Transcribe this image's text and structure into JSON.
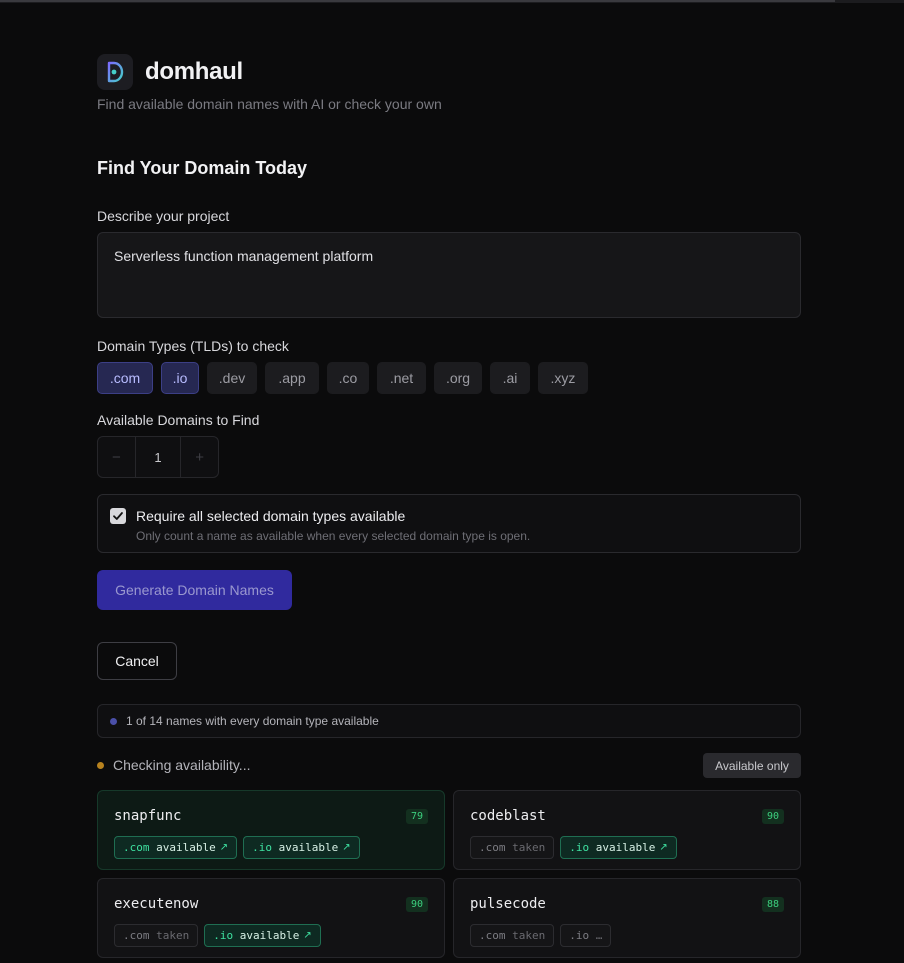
{
  "app": {
    "name": "domhaul",
    "tagline": "Find available domain names with AI or check your own",
    "accent": "#302a9e",
    "logo_icon": "logo-d-icon"
  },
  "form": {
    "section_title": "Find Your Domain Today",
    "project_label": "Describe your project",
    "project_value": "Serverless function management platform",
    "tld_label": "Domain Types (TLDs) to check",
    "tlds": [
      {
        "label": ".com",
        "selected": true
      },
      {
        "label": ".io",
        "selected": true
      },
      {
        "label": ".dev",
        "selected": false
      },
      {
        "label": ".app",
        "selected": false
      },
      {
        "label": ".co",
        "selected": false
      },
      {
        "label": ".net",
        "selected": false
      },
      {
        "label": ".org",
        "selected": false
      },
      {
        "label": ".ai",
        "selected": false
      },
      {
        "label": ".xyz",
        "selected": false
      }
    ],
    "count_label": "Available Domains to Find",
    "count_minus": "−",
    "count_value": "1",
    "count_plus": "+",
    "require_all_title": "Require all selected domain types available",
    "require_all_sub": "Only count a name as available when every selected domain type is open.",
    "require_all_checked": true,
    "generate_label": "Generate Domain Names",
    "cancel_label": "Cancel"
  },
  "results": {
    "summary": "1 of 14 names with every domain type available",
    "checking": "Checking availability...",
    "filter_label": "Available only",
    "cards": [
      {
        "name": "snapfunc",
        "score": "79",
        "highlight": true,
        "chips": [
          {
            "ext": ".com",
            "status": "available",
            "ok": true
          },
          {
            "ext": ".io",
            "status": "available",
            "ok": true
          }
        ]
      },
      {
        "name": "codeblast",
        "score": "90",
        "highlight": false,
        "chips": [
          {
            "ext": ".com",
            "status": "taken",
            "ok": false
          },
          {
            "ext": ".io",
            "status": "available",
            "ok": true
          }
        ]
      },
      {
        "name": "executenow",
        "score": "90",
        "highlight": false,
        "chips": [
          {
            "ext": ".com",
            "status": "taken",
            "ok": false
          },
          {
            "ext": ".io",
            "status": "available",
            "ok": true
          }
        ]
      },
      {
        "name": "pulsecode",
        "score": "88",
        "highlight": false,
        "chips": [
          {
            "ext": ".com",
            "status": "taken",
            "ok": false
          },
          {
            "ext": ".io",
            "status": "…",
            "ok": false
          }
        ]
      }
    ]
  }
}
